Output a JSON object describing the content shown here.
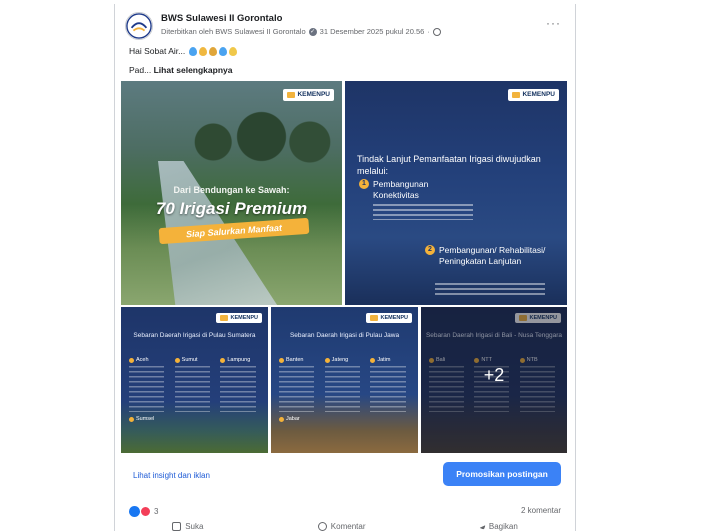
{
  "post": {
    "page_name": "BWS Sulawesi II Gorontalo",
    "published_by": "Diterbitkan oleh BWS Sulawesi II Gorontalo",
    "timestamp": "31 Desember 2025 pukul 20.56",
    "more": "···",
    "text_line1": "Hai Sobat Air...",
    "text_line2_prefix": "Pad...",
    "see_more": "Lihat selengkapnya"
  },
  "images": {
    "logo_text": "KEMENPU",
    "tile1": {
      "subtitle": "Dari Bendungan ke Sawah:",
      "title": "70 Irigasi Premium",
      "pill": "Siap Salurkan Manfaat"
    },
    "tile2": {
      "heading": "Tindak Lanjut Pemanfaatan Irigasi diwujudkan melalui:",
      "item1_num": "1",
      "item1": "Pembangunan Konektivitas",
      "item2_num": "2",
      "item2": "Pembangunan/ Rehabilitasi/ Peningkatan Lanjutan"
    },
    "tile3": {
      "title": "Sebaran Daerah Irigasi di Pulau Sumatera",
      "col1": "Aceh",
      "col2": "Sumut",
      "col3": "Lampung",
      "col4": "Sumsel"
    },
    "tile4": {
      "title": "Sebaran Daerah Irigasi di Pulau Jawa",
      "col1": "Banten",
      "col2": "Jateng",
      "col3": "Jatim",
      "col4": "Jabar"
    },
    "tile5": {
      "title": "Sebaran Daerah Irigasi di Bali - Nusa Tenggara",
      "col1": "Bali",
      "col2": "NTT",
      "col3": "NTB",
      "more_count": "+2"
    }
  },
  "footer": {
    "insight_link": "Lihat insight dan iklan",
    "promote_button": "Promosikan postingan",
    "reaction_count": "3",
    "comment_count": "2 komentar",
    "like": "Suka",
    "comment": "Komentar",
    "share": "Bagikan"
  },
  "colors": {
    "promote_bg": "#3b82f6",
    "link": "#1e5bd6",
    "accent_yellow": "#f4b23a",
    "navy": "#1e3466"
  }
}
